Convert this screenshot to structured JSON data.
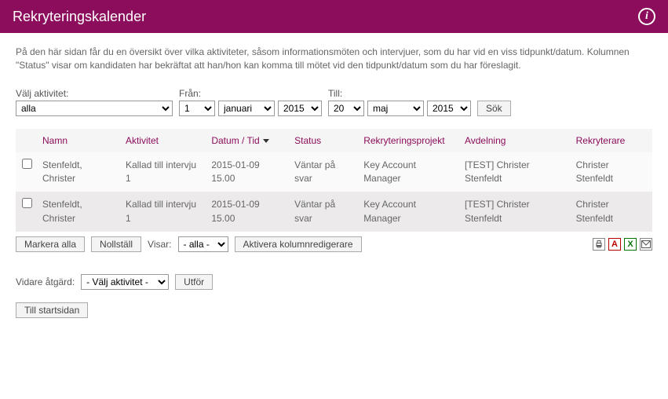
{
  "header": {
    "title": "Rekryteringskalender"
  },
  "intro": "På den här sidan får du en översikt över vilka aktiviteter, såsom informationsmöten och intervjuer, som du har vid en viss tidpunkt/datum. Kolumnen \"Status\" visar om kandidaten har bekräftat att han/hon kan komma till mötet vid den tidpunkt/datum som du har föreslagit.",
  "filters": {
    "activity_label": "Välj aktivitet:",
    "activity_value": "alla",
    "from_label": "Från:",
    "from_day": "1",
    "from_month": "januari",
    "from_year": "2015",
    "to_label": "Till:",
    "to_day": "20",
    "to_month": "maj",
    "to_year": "2015",
    "search_btn": "Sök"
  },
  "table": {
    "headers": {
      "name": "Namn",
      "activity": "Aktivitet",
      "datetime": "Datum / Tid",
      "status": "Status",
      "project": "Rekryteringsprojekt",
      "department": "Avdelning",
      "recruiter": "Rekryterare"
    },
    "rows": [
      {
        "name": "Stenfeldt, Christer",
        "activity": "Kallad till intervju 1",
        "datetime": "2015-01-09 15.00",
        "status": "Väntar på svar",
        "project": "Key Account Manager",
        "department": "[TEST] Christer Stenfeldt",
        "recruiter": "Christer Stenfeldt"
      },
      {
        "name": "Stenfeldt, Christer",
        "activity": "Kallad till intervju 1",
        "datetime": "2015-01-09 15.00",
        "status": "Väntar på svar",
        "project": "Key Account Manager",
        "department": "[TEST] Christer Stenfeldt",
        "recruiter": "Christer Stenfeldt"
      }
    ]
  },
  "below": {
    "mark_all": "Markera alla",
    "reset": "Nollställ",
    "showing_label": "Visar:",
    "showing_value": "- alla -",
    "column_editor": "Aktivera kolumnredigerare"
  },
  "action": {
    "label": "Vidare åtgärd:",
    "value": "- Välj aktivitet -",
    "execute": "Utför"
  },
  "back_btn": "Till startsidan"
}
